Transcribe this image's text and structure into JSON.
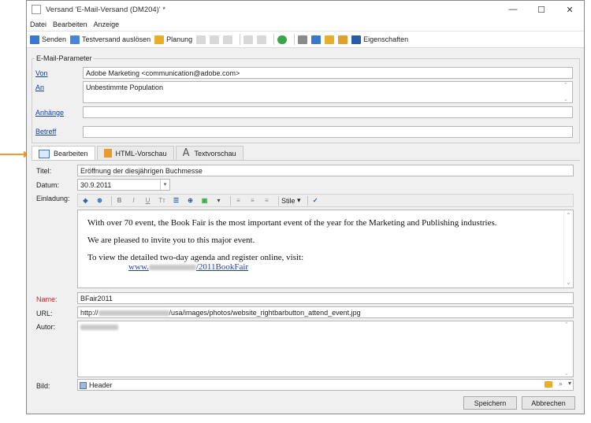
{
  "window": {
    "title": "Versand 'E-Mail-Versand (DM204)' *",
    "controls": [
      "—",
      "☐",
      "✕"
    ]
  },
  "menu": [
    "Datei",
    "Bearbeiten",
    "Anzeige"
  ],
  "toolbar": {
    "send": "Senden",
    "test_send": "Testversand auslösen",
    "planning": "Planung",
    "properties": "Eigenschaften"
  },
  "params": {
    "group_label": "E-Mail-Parameter",
    "from_label": "Von",
    "from_value": "Adobe Marketing <communication@adobe.com>",
    "to_label": "An",
    "to_value": "Unbestimmte Population",
    "attachments_label": "Anhänge",
    "attachments_value": "",
    "subject_label": "Betreff",
    "subject_value": ""
  },
  "tabs": [
    "Bearbeiten",
    "HTML-Vorschau",
    "Textvorschau"
  ],
  "content": {
    "title_label": "Titel:",
    "title_value": "Eröffnung der diesjährigen Buchmesse",
    "date_label": "Datum:",
    "date_value": "30.9.2011",
    "invitation_label": "Einladung:",
    "styles_label": "Stile",
    "editor_p1": "With over 70 event, the Book Fair is the most important event of the year for the Marketing and Publishing industries.",
    "editor_p2": "We are pleased to invite you to this major event.",
    "editor_p3": "To view the detailed two-day agenda and register online, visit:",
    "editor_link_prefix": "www.",
    "editor_link_suffix": "/2011BookFair",
    "name_label": "Name:",
    "name_value": "BFair2011",
    "url_label": "URL:",
    "url_prefix": "http://",
    "url_suffix": "/usa/images/photos/website_rightbarbutton_attend_event.jpg",
    "author_label": "Autor:",
    "image_label": "Bild:",
    "image_value": "Header"
  },
  "buttons": {
    "save": "Speichern",
    "cancel": "Abbrechen"
  },
  "colors": {
    "arrow": "#f29a2e",
    "link": "#0a3fb8",
    "required_label": "#d02020"
  }
}
